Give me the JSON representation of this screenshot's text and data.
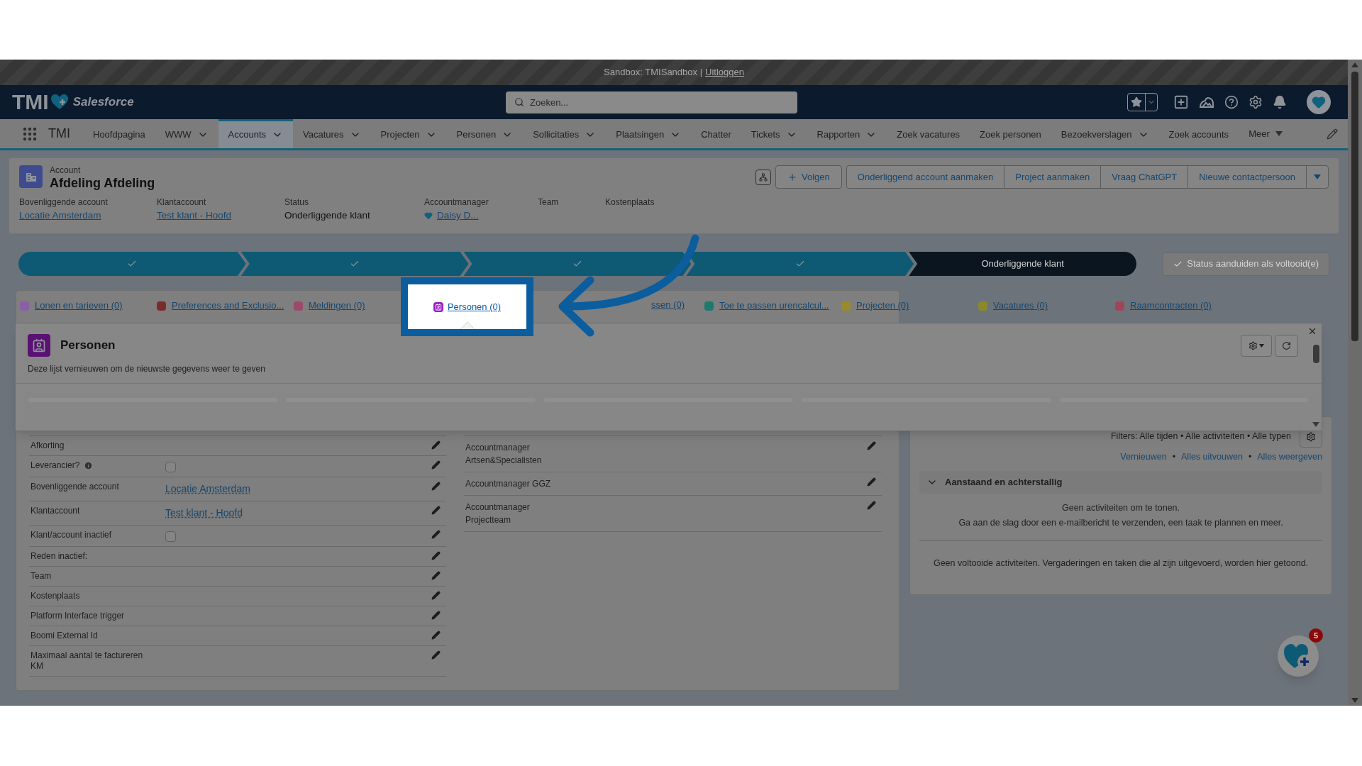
{
  "sandbox_bar": {
    "text": "Sandbox: TMISandbox |",
    "link": "Uitloggen"
  },
  "header": {
    "logo": "TMI",
    "brand": "Salesforce",
    "search_placeholder": "Zoeken..."
  },
  "nav": {
    "app_name": "TMI",
    "more": "Meer",
    "items": [
      {
        "label": "Hoofdpagina",
        "menu": false,
        "selected": false
      },
      {
        "label": "WWW",
        "menu": true,
        "selected": false
      },
      {
        "label": "Accounts",
        "menu": true,
        "selected": true
      },
      {
        "label": "Vacatures",
        "menu": true,
        "selected": false
      },
      {
        "label": "Projecten",
        "menu": true,
        "selected": false
      },
      {
        "label": "Personen",
        "menu": true,
        "selected": false
      },
      {
        "label": "Sollicitaties",
        "menu": true,
        "selected": false
      },
      {
        "label": "Plaatsingen",
        "menu": true,
        "selected": false
      },
      {
        "label": "Chatter",
        "menu": false,
        "selected": false
      },
      {
        "label": "Tickets",
        "menu": true,
        "selected": false
      },
      {
        "label": "Rapporten",
        "menu": true,
        "selected": false
      },
      {
        "label": "Zoek vacatures",
        "menu": false,
        "selected": false
      },
      {
        "label": "Zoek personen",
        "menu": false,
        "selected": false
      },
      {
        "label": "Bezoekverslagen",
        "menu": true,
        "selected": false
      },
      {
        "label": "Zoek accounts",
        "menu": false,
        "selected": false
      }
    ]
  },
  "record": {
    "type": "Account",
    "name": "Afdeling Afdeling",
    "actions": [
      "Volgen",
      "Onderliggend account aanmaken",
      "Project aanmaken",
      "Vraag ChatGPT",
      "Nieuwe contactpersoon"
    ],
    "fields": [
      {
        "label": "Bovenliggende account",
        "value": "Locatie Amsterdam",
        "kind": "link"
      },
      {
        "label": "Klantaccount",
        "value": "Test klant - Hoofd",
        "kind": "link"
      },
      {
        "label": "Status",
        "value": "Onderliggende klant",
        "kind": "text"
      },
      {
        "label": "Accountmanager",
        "value": "Daisy D...",
        "kind": "user"
      },
      {
        "label": "Team",
        "kind": "empty"
      },
      {
        "label": "Kostenplaats",
        "kind": "empty"
      }
    ]
  },
  "path": {
    "steps": [
      {
        "kind": "complete"
      },
      {
        "kind": "complete"
      },
      {
        "kind": "complete"
      },
      {
        "kind": "complete"
      },
      {
        "kind": "current",
        "label": "Onderliggende klant"
      }
    ],
    "complete_button": {
      "label": "Status aanduiden als voltooid(e)",
      "disabled": true
    }
  },
  "related_links": [
    {
      "label": "Lonen en tarieven (0)",
      "color": "#8b5ea8",
      "kind": "link"
    },
    {
      "label": "Preferences and Exclusio...",
      "color": "#7a2c2c",
      "kind": "link"
    },
    {
      "label": "Meldingen (0)",
      "color": "#9a4a6a",
      "kind": "link"
    },
    {
      "label": "Personen (0)",
      "color": "#9b1fc6",
      "kind": "highlighted"
    },
    {
      "label": "ssen (0)",
      "kind": "covered"
    },
    {
      "label": "Toe te passen urencalcul...",
      "color": "#1f7a6e",
      "kind": "link"
    },
    {
      "label": "Projecten (0)",
      "color": "#9a8a2a",
      "kind": "link"
    },
    {
      "label": "Vacatures (0)",
      "color": "#8a8a2a",
      "kind": "link"
    },
    {
      "label": "Raamcontracten (0)",
      "color": "#a0445a",
      "kind": "link"
    }
  ],
  "related_list_popup": {
    "title": "Personen",
    "subtitle": "Deze lijst vernieuwen om de nieuwste gegevens weer te geven"
  },
  "details_left": [
    {
      "label": "Afkorting",
      "kind": "empty",
      "info": false
    },
    {
      "label": "Leverancier?",
      "kind": "checkbox",
      "checked": false,
      "info": true
    },
    {
      "label": "Bovenliggende account",
      "kind": "link",
      "value": "Locatie Amsterdam",
      "info": false
    },
    {
      "label": "Klantaccount",
      "kind": "link",
      "value": "Test klant - Hoofd",
      "info": false
    },
    {
      "label": "Klant/account inactief",
      "kind": "checkbox",
      "checked": false,
      "info": false
    },
    {
      "label": "Reden inactief:",
      "kind": "empty",
      "info": false
    },
    {
      "label": "Team",
      "kind": "empty",
      "info": false
    },
    {
      "label": "Kostenplaats",
      "kind": "empty",
      "info": false
    },
    {
      "label": "Platform Interface trigger",
      "kind": "empty",
      "info": false
    },
    {
      "label": "Boomi External Id",
      "kind": "empty",
      "info": false
    },
    {
      "label": "Maximaal aantal te factureren KM",
      "kind": "empty",
      "info": false
    }
  ],
  "details_right": [
    {
      "label": "Accountmanager Artsen&Specialisten"
    },
    {
      "label": "Accountmanager GGZ"
    },
    {
      "label": "Accountmanager Projectteam"
    }
  ],
  "activity": {
    "filters": "Filters: Alle tijden • Alle activiteiten • Alle typen",
    "links": [
      "Vernieuwen",
      "Alles uitvouwen",
      "Alles weergeven"
    ],
    "separator": "•",
    "section": {
      "title": "Aanstaand en achterstallig",
      "expanded": true,
      "empty_lines": [
        "Geen activiteiten om te tonen.",
        "Ga aan de slag door een e-mailbericht te verzenden, een taak te plannen en meer."
      ]
    },
    "past_empty": "Geen voltooide activiteiten. Vergaderingen en taken die al zijn uitgevoerd, worden hier getoond."
  },
  "assistant_button": {
    "badge": "5"
  }
}
